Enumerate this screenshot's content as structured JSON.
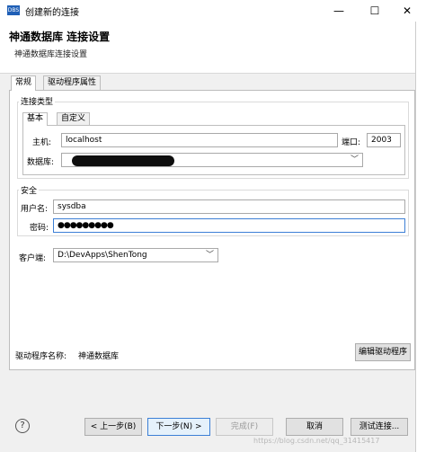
{
  "window": {
    "icon_text": "DBS",
    "title": "创建新的连接",
    "minimize": "—",
    "maximize": "☐",
    "close": "✕"
  },
  "header": {
    "title": "神通数据库 连接设置",
    "subtitle": "神通数据库连接设置"
  },
  "tabs": [
    {
      "label": "常规",
      "active": true
    },
    {
      "label": "驱动程序属性",
      "active": false
    }
  ],
  "connection_type": {
    "label": "连接类型",
    "subtabs": [
      {
        "label": "基本",
        "active": true
      },
      {
        "label": "自定义",
        "active": false
      }
    ],
    "host_label": "主机:",
    "host_value": "localhost",
    "port_label": "端口:",
    "port_value": "2003",
    "database_label": "数据库:",
    "database_value": ""
  },
  "security": {
    "label": "安全",
    "username_label": "用户名:",
    "username_value": "sysdba",
    "password_label": "密码:",
    "password_value": "●●●●●●●●●"
  },
  "client": {
    "label": "客户端:",
    "value": "D:\\DevApps\\ShenTong"
  },
  "driver": {
    "label": "驱动程序名称:",
    "value": "神通数据库",
    "edit_button": "编辑驱动程序"
  },
  "footer": {
    "help": "?",
    "back": "< 上一步(B)",
    "next": "下一步(N) >",
    "finish": "完成(F)",
    "cancel": "取消",
    "test": "测试连接..."
  },
  "watermark": "https://blog.csdn.net/qq_31415417"
}
